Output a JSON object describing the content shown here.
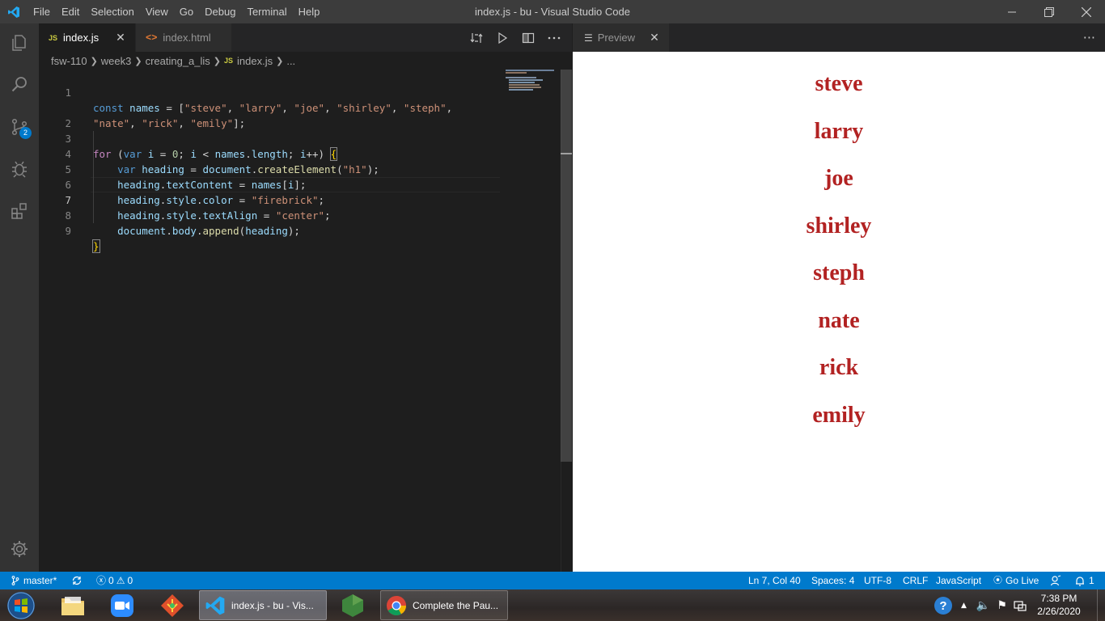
{
  "window": {
    "title": "index.js - bu - Visual Studio Code",
    "menu": [
      "File",
      "Edit",
      "Selection",
      "View",
      "Go",
      "Debug",
      "Terminal",
      "Help"
    ]
  },
  "activity_bar": {
    "items": [
      "explorer-icon",
      "search-icon",
      "source-control-icon",
      "debug-icon",
      "extensions-icon"
    ],
    "scm_badge": "2",
    "bottom": "settings-gear-icon"
  },
  "editor": {
    "tabs": [
      {
        "label": "index.js",
        "icon": "JS",
        "active": true
      },
      {
        "label": "index.html",
        "icon": "<>",
        "active": false
      }
    ],
    "breadcrumb": [
      "fsw-110",
      "week3",
      "creating_a_lis",
      "index.js",
      "..."
    ],
    "breadcrumb_file_icon": "JS",
    "line_numbers": [
      "1",
      "",
      "2",
      "3",
      "4",
      "5",
      "6",
      "7",
      "8",
      "9"
    ],
    "lines": [
      "const names = [\"steve\", \"larry\", \"joe\", \"shirley\", \"steph\",",
      "\"nate\", \"rick\", \"emily\"];",
      "",
      "for (var i = 0; i < names.length; i++) {",
      "    var heading = document.createElement(\"h1\");",
      "    heading.textContent = names[i];",
      "    heading.style.color = \"firebrick\";",
      "    heading.style.textAlign = \"center\";",
      "    document.body.append(heading);",
      "}"
    ],
    "current_line": "7"
  },
  "preview": {
    "tab_label": "Preview",
    "headings": [
      "steve",
      "larry",
      "joe",
      "shirley",
      "steph",
      "nate",
      "rick",
      "emily"
    ],
    "heading_color": "#b22222"
  },
  "statusbar": {
    "branch": "master*",
    "errors": "0",
    "warnings": "0",
    "position": "Ln 7, Col 40",
    "spaces": "Spaces: 4",
    "encoding": "UTF-8",
    "eol": "CRLF",
    "language": "JavaScript",
    "go_live": "Go Live",
    "notifications": "1",
    "accent": "#007acc"
  },
  "taskbar": {
    "vscode_label": "index.js - bu - Vis...",
    "chrome_label": "Complete the Pau...",
    "time": "7:38 PM",
    "date": "2/26/2020"
  }
}
